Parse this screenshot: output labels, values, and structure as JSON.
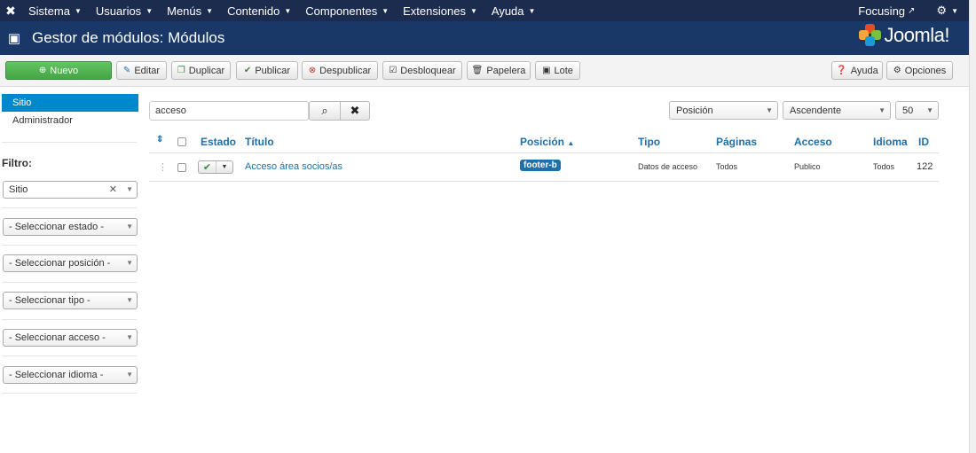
{
  "nav": {
    "items": [
      {
        "label": "Sistema"
      },
      {
        "label": "Usuarios"
      },
      {
        "label": "Menús"
      },
      {
        "label": "Contenido"
      },
      {
        "label": "Componentes"
      },
      {
        "label": "Extensiones"
      },
      {
        "label": "Ayuda"
      }
    ],
    "site_link": "Focusing"
  },
  "header": {
    "title": "Gestor de módulos: Módulos",
    "brand": "Joomla!"
  },
  "toolbar": {
    "nuevo": "Nuevo",
    "editar": "Editar",
    "duplicar": "Duplicar",
    "publicar": "Publicar",
    "despublicar": "Despublicar",
    "desbloquear": "Desbloquear",
    "papelera": "Papelera",
    "lote": "Lote",
    "ayuda": "Ayuda",
    "opciones": "Opciones"
  },
  "sidebar": {
    "items": [
      {
        "label": "Sitio",
        "active": true
      },
      {
        "label": "Administrador",
        "active": false
      }
    ],
    "filter_label": "Filtro:",
    "filters": [
      {
        "label": "Sitio"
      },
      {
        "label": "- Seleccionar estado -"
      },
      {
        "label": "- Seleccionar posición -"
      },
      {
        "label": "- Seleccionar tipo -"
      },
      {
        "label": "- Seleccionar acceso -"
      },
      {
        "label": "- Seleccionar idioma -"
      }
    ]
  },
  "search": {
    "value": "acceso"
  },
  "list_controls": {
    "order_by": "Posición",
    "direction": "Ascendente",
    "limit": "50"
  },
  "table": {
    "headers": {
      "estado": "Estado",
      "titulo": "Título",
      "posicion": "Posición",
      "tipo": "Tipo",
      "paginas": "Páginas",
      "acceso": "Acceso",
      "idioma": "Idioma",
      "id": "ID"
    },
    "rows": [
      {
        "titulo": "Acceso área socios/as",
        "posicion": "footer-b",
        "tipo": "Datos de acceso",
        "paginas": "Todos",
        "acceso": "Publico",
        "idioma": "Todos",
        "id": "122"
      }
    ]
  },
  "colors": {
    "navbar": "#1b2c4f",
    "header": "#1a3867",
    "accent": "#0088cc",
    "link": "#1f6fa8",
    "success": "#46a546"
  }
}
